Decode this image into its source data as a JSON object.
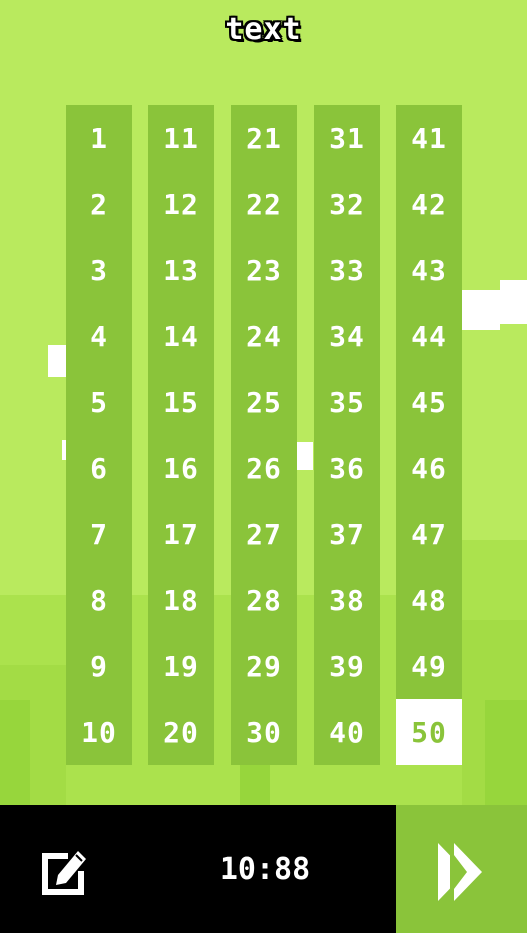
{
  "title": "text",
  "levels": {
    "columns": [
      [
        "1",
        "2",
        "3",
        "4",
        "5",
        "6",
        "7",
        "8",
        "9",
        "10"
      ],
      [
        "11",
        "12",
        "13",
        "14",
        "15",
        "16",
        "17",
        "18",
        "19",
        "20"
      ],
      [
        "21",
        "22",
        "23",
        "24",
        "25",
        "26",
        "27",
        "28",
        "29",
        "30"
      ],
      [
        "31",
        "32",
        "33",
        "34",
        "35",
        "36",
        "37",
        "38",
        "39",
        "40"
      ],
      [
        "41",
        "42",
        "43",
        "44",
        "45",
        "46",
        "47",
        "48",
        "49",
        "50"
      ]
    ],
    "selected": "50"
  },
  "footer": {
    "timer": "10:88",
    "edit_icon": "edit-icon",
    "play_icon": "fast-forward-icon"
  },
  "colors": {
    "background": "#b9ea5e",
    "column": "#8ac43a",
    "selected_tile": "#ffffff",
    "bar": "#000000"
  }
}
